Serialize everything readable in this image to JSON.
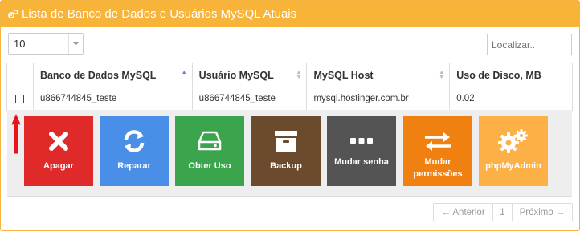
{
  "header": {
    "title": "Lista de Banco de Dados e Usuários MySQL Atuais",
    "icon": "gears-icon"
  },
  "controls": {
    "page_length": "10",
    "search_placeholder": "Localizar.."
  },
  "table": {
    "columns": [
      "Banco de Dados MySQL",
      "Usuário MySQL",
      "MySQL Host",
      "Uso de Disco, MB"
    ],
    "rows": [
      {
        "database": "u866744845_teste",
        "user": "u866744845_teste",
        "host": "mysql.hostinger.com.br",
        "disk_usage": "0.02"
      }
    ]
  },
  "actions": [
    {
      "label": "Apagar",
      "icon": "x-icon",
      "color": "#e02a2a"
    },
    {
      "label": "Reparar",
      "icon": "refresh-icon",
      "color": "#4a8fe7"
    },
    {
      "label": "Obter Uso",
      "icon": "drive-icon",
      "color": "#3aa54c"
    },
    {
      "label": "Backup",
      "icon": "archive-icon",
      "color": "#6b4a2e"
    },
    {
      "label": "Mudar senha",
      "icon": "dots-icon",
      "color": "#545454"
    },
    {
      "label": "Mudar permissões",
      "icon": "swap-arrows-icon",
      "color": "#f0800f"
    },
    {
      "label": "phpMyAdmin",
      "icon": "gears-icon",
      "color": "#fdb046"
    }
  ],
  "pagination": {
    "prev": "← Anterior",
    "page": "1",
    "next": "Próximo →"
  },
  "colors": {
    "header": "#f8b339",
    "annotation_arrow": "#e8141c"
  }
}
